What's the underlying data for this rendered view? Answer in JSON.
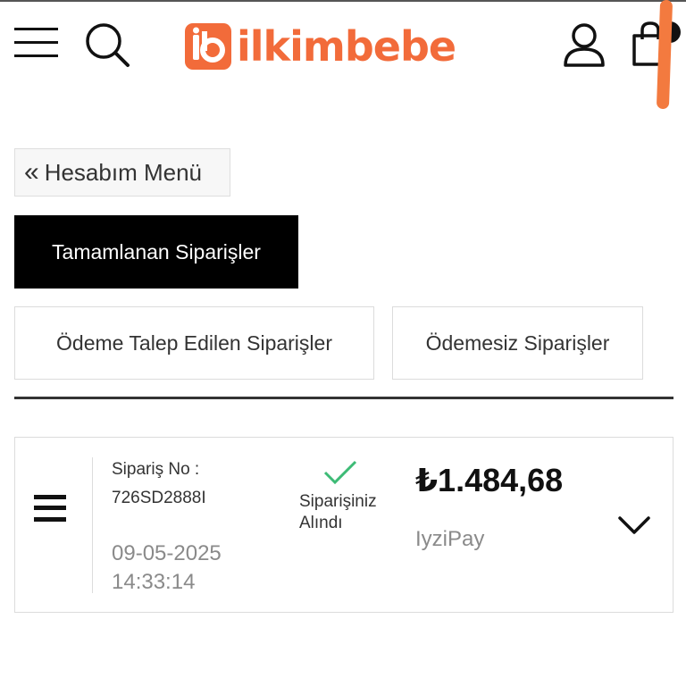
{
  "header": {
    "brand": "ilkimbebe",
    "menu_icon": "hamburger-icon",
    "search_icon": "search-icon",
    "account_icon": "user-icon",
    "cart_icon": "shopping-bag-icon",
    "brand_color": "#f26b3a"
  },
  "account": {
    "back_chevron": "«",
    "back_label": "Hesabım Menü"
  },
  "tabs": [
    {
      "label": "Tamamlanan Siparişler",
      "active": true
    },
    {
      "label": "Ödeme Talep Edilen Siparişler",
      "active": false
    },
    {
      "label": "Ödemesiz Siparişler",
      "active": false
    }
  ],
  "order": {
    "menu_icon": "list-icon",
    "number_label": "Sipariş No :",
    "number": "726SD2888I",
    "date": "09-05-2025",
    "time": "14:33:14",
    "status_icon": "check-icon",
    "status_line1": "Siparişiniz",
    "status_line2": "Alındı",
    "status_color": "#3dbb76",
    "total": "₺1.484,68",
    "payment_method": "IyziPay",
    "expand_icon": "chevron-down-icon"
  }
}
